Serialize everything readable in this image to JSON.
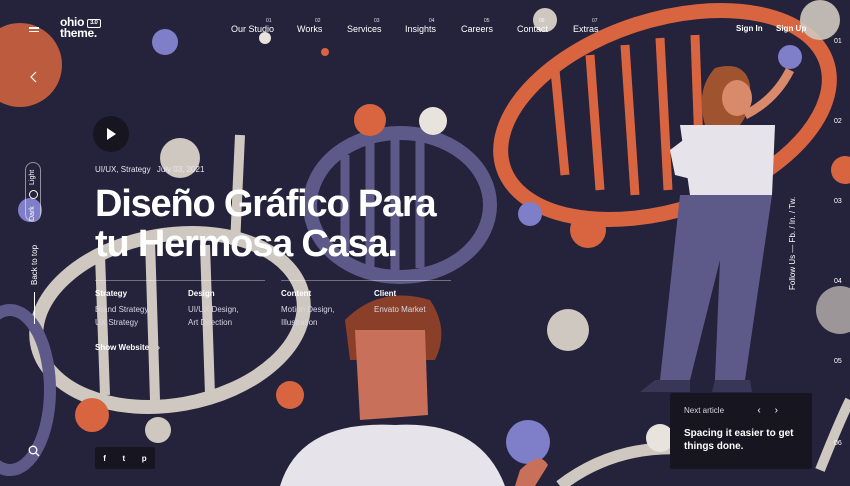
{
  "logo": {
    "line1": "ohio",
    "line2": "theme.",
    "version": "3.0"
  },
  "nav": [
    {
      "num": "01",
      "label": "Our Studio"
    },
    {
      "num": "02",
      "label": "Works"
    },
    {
      "num": "03",
      "label": "Services"
    },
    {
      "num": "04",
      "label": "Insights"
    },
    {
      "num": "05",
      "label": "Careers"
    },
    {
      "num": "06",
      "label": "Contact"
    },
    {
      "num": "07",
      "label": "Extras"
    }
  ],
  "auth": {
    "sign_in": "Sign In",
    "sign_up": "Sign Up"
  },
  "theme_toggle": {
    "light": "Light",
    "dark": "Dark"
  },
  "back_to_top": "Back to top",
  "hero": {
    "category": "UI/UX, Strategy",
    "date": "July 03, 2021",
    "title_line1": "Diseño Gráfico Para",
    "title_line2": "tu Hermosa Casa."
  },
  "details": [
    {
      "heading": "Strategy",
      "line1": "Brand Strategy,",
      "line2": "UX Strategy"
    },
    {
      "heading": "Design",
      "line1": "UI/UX Design,",
      "line2": "Art Direction"
    },
    {
      "heading": "Content",
      "line1": "Motion Design,",
      "line2": "Illustration"
    },
    {
      "heading": "Client",
      "line1": "Envato Market",
      "line2": ""
    }
  ],
  "show_website": "Show Website",
  "social": {
    "facebook": "f",
    "twitter": "t",
    "pinterest": "p"
  },
  "follow": "Follow Us — Fb. / In. / Tw.",
  "pagination": [
    "01",
    "02",
    "03",
    "04",
    "05",
    "06"
  ],
  "next_article": {
    "label": "Next article",
    "title_line1": "Spacing it easier to get",
    "title_line2": "things done."
  },
  "colors": {
    "background": "#25223b",
    "orange": "#d8653f",
    "periwinkle": "#7f7ec9",
    "cream": "#d6cfc7",
    "dark_panel": "#17151f"
  }
}
